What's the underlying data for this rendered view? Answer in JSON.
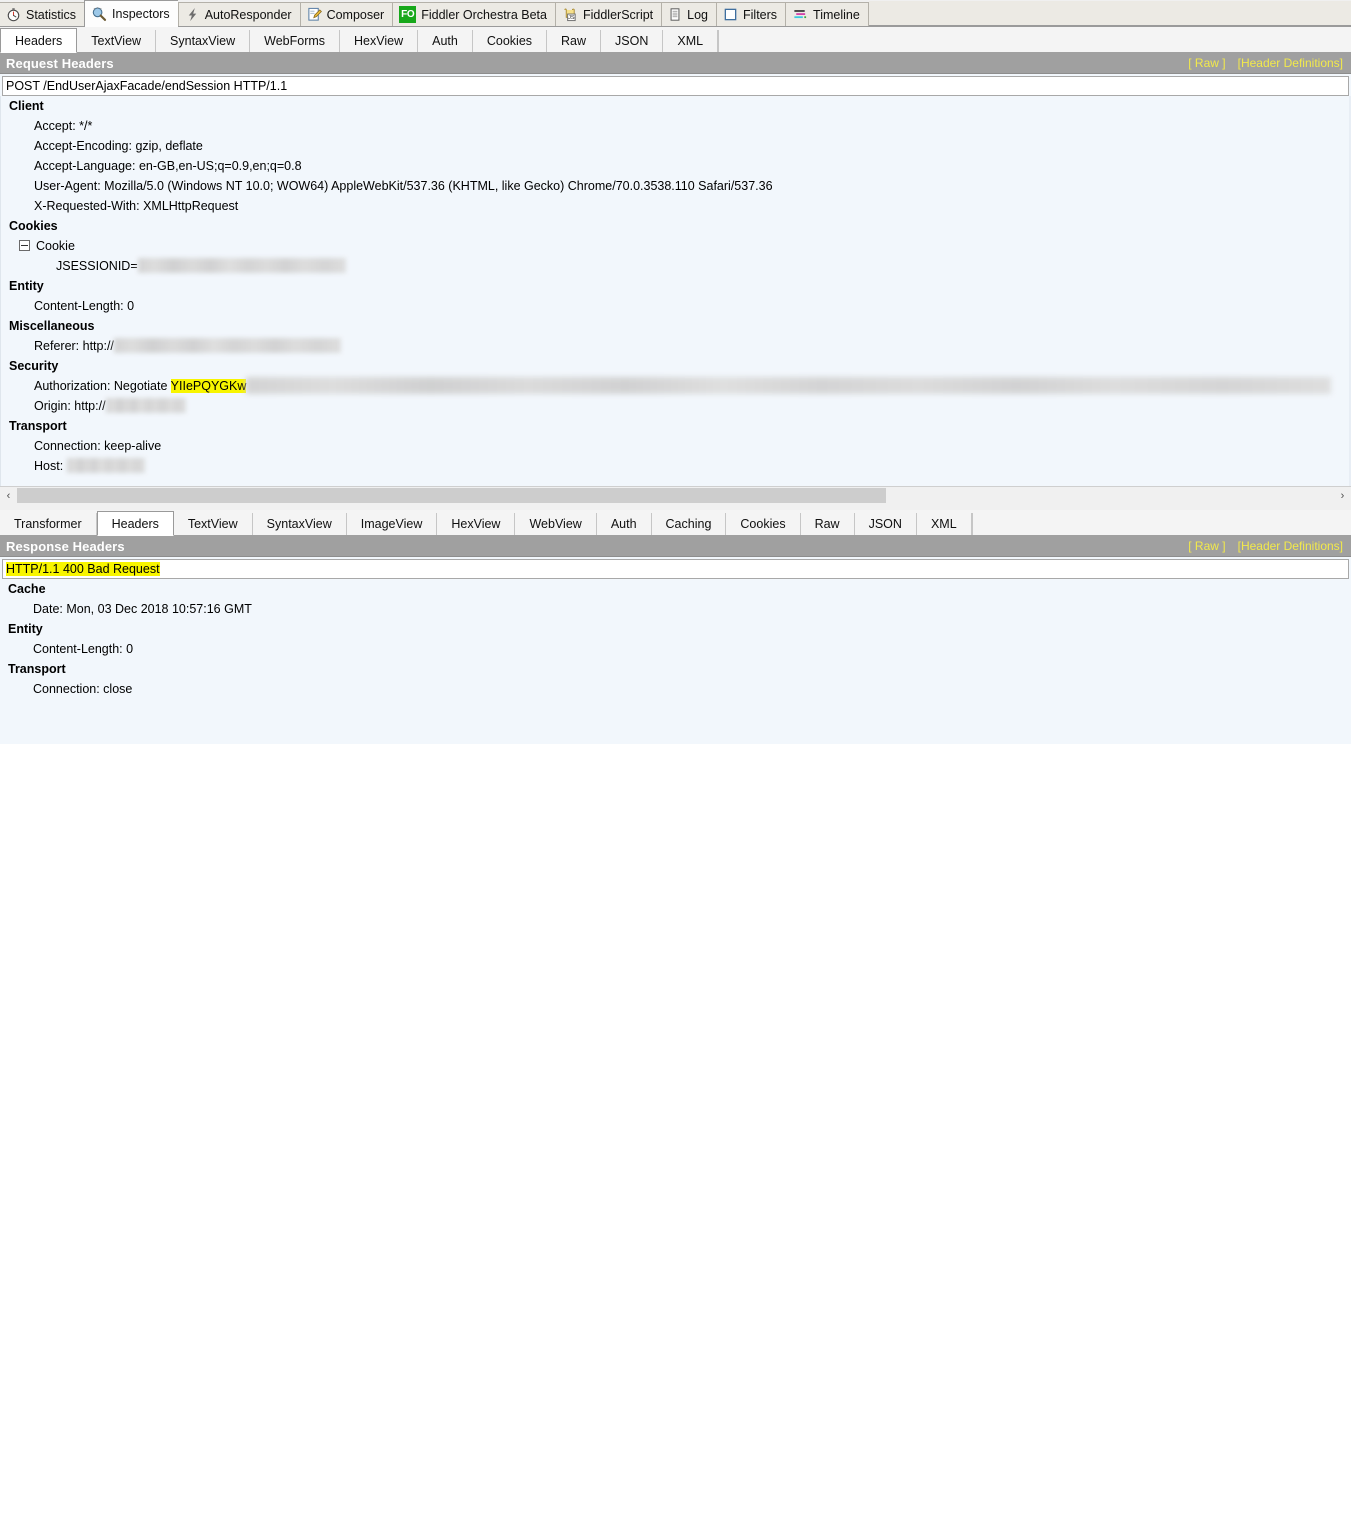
{
  "main_tabs": [
    {
      "label": "Statistics",
      "icon": "stopwatch-icon",
      "active": false
    },
    {
      "label": "Inspectors",
      "icon": "magnifier-icon",
      "active": true
    },
    {
      "label": "AutoResponder",
      "icon": "lightning-bolt-icon",
      "active": false
    },
    {
      "label": "Composer",
      "icon": "pencil-notepad-icon",
      "active": false
    },
    {
      "label": "Fiddler Orchestra Beta",
      "icon": "fo-badge-icon",
      "active": false
    },
    {
      "label": "FiddlerScript",
      "icon": "js-scroll-icon",
      "active": false
    },
    {
      "label": "Log",
      "icon": "document-lines-icon",
      "active": false
    },
    {
      "label": "Filters",
      "icon": "checkbox-empty-icon",
      "active": false
    },
    {
      "label": "Timeline",
      "icon": "timeline-bars-icon",
      "active": false
    }
  ],
  "request": {
    "tabs": [
      {
        "label": "Headers",
        "active": true
      },
      {
        "label": "TextView",
        "active": false
      },
      {
        "label": "SyntaxView",
        "active": false
      },
      {
        "label": "WebForms",
        "active": false
      },
      {
        "label": "HexView",
        "active": false
      },
      {
        "label": "Auth",
        "active": false
      },
      {
        "label": "Cookies",
        "active": false
      },
      {
        "label": "Raw",
        "active": false
      },
      {
        "label": "JSON",
        "active": false
      },
      {
        "label": "XML",
        "active": false
      }
    ],
    "section_title": "Request Headers",
    "link_raw": "[ Raw ]",
    "link_header_definitions": "[Header Definitions]",
    "request_line": "POST /EndUserAjaxFacade/endSession HTTP/1.1",
    "groups": [
      {
        "name": "Client",
        "rows": [
          {
            "text": "Accept: */*"
          },
          {
            "text": "Accept-Encoding: gzip, deflate"
          },
          {
            "text": "Accept-Language: en-GB,en-US;q=0.9,en;q=0.8"
          },
          {
            "text": "User-Agent: Mozilla/5.0 (Windows NT 10.0; WOW64) AppleWebKit/537.36 (KHTML, like Gecko) Chrome/70.0.3538.110 Safari/537.36"
          },
          {
            "text": "X-Requested-With: XMLHttpRequest"
          }
        ]
      },
      {
        "name": "Cookies",
        "subnode": "Cookie",
        "rows": [
          {
            "text": "JSESSIONID=",
            "redacted": true
          }
        ]
      },
      {
        "name": "Entity",
        "rows": [
          {
            "text": "Content-Length: 0"
          }
        ]
      },
      {
        "name": "Miscellaneous",
        "rows": [
          {
            "text": "Referer: http://",
            "redacted": true
          }
        ]
      },
      {
        "name": "Security",
        "rows": [
          {
            "text": "Authorization: Negotiate ",
            "highlight": "YIIePQYGKw",
            "redacted": true
          },
          {
            "text": "Origin: http://",
            "redacted": true
          }
        ]
      },
      {
        "name": "Transport",
        "rows": [
          {
            "text": "Connection: keep-alive"
          },
          {
            "text": "Host: ",
            "redacted": true
          }
        ]
      }
    ]
  },
  "response": {
    "tabs": [
      {
        "label": "Transformer",
        "active": false
      },
      {
        "label": "Headers",
        "active": true
      },
      {
        "label": "TextView",
        "active": false
      },
      {
        "label": "SyntaxView",
        "active": false
      },
      {
        "label": "ImageView",
        "active": false
      },
      {
        "label": "HexView",
        "active": false
      },
      {
        "label": "WebView",
        "active": false
      },
      {
        "label": "Auth",
        "active": false
      },
      {
        "label": "Caching",
        "active": false
      },
      {
        "label": "Cookies",
        "active": false
      },
      {
        "label": "Raw",
        "active": false
      },
      {
        "label": "JSON",
        "active": false
      },
      {
        "label": "XML",
        "active": false
      }
    ],
    "section_title": "Response Headers",
    "link_raw": "[ Raw ]",
    "link_header_definitions": "[Header Definitions]",
    "status_line": "HTTP/1.1 400 Bad Request",
    "groups": [
      {
        "name": "Cache",
        "rows": [
          {
            "text": "Date: Mon, 03 Dec 2018 10:57:16 GMT"
          }
        ]
      },
      {
        "name": "Entity",
        "rows": [
          {
            "text": "Content-Length: 0"
          }
        ]
      },
      {
        "name": "Transport",
        "rows": [
          {
            "text": "Connection: close"
          }
        ]
      }
    ]
  },
  "scrollbar": {
    "left_arrow": "‹",
    "right_arrow": "›",
    "thumb_percent": 66
  },
  "colors": {
    "section_bar": "#a0a0a0",
    "section_link": "#f2e94b",
    "highlight": "#f8f500",
    "tree_bg": "#f2f7fc",
    "orchestra_badge": "#17a81a"
  }
}
